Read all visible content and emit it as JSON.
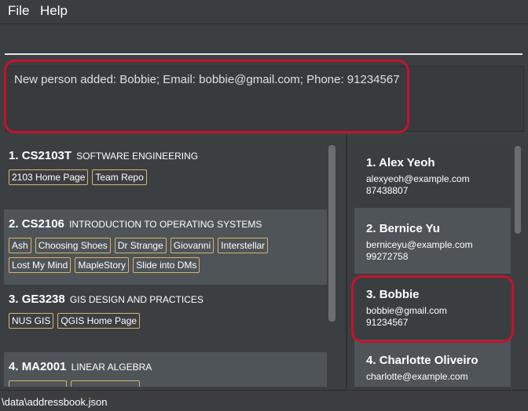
{
  "menu": {
    "file": "File",
    "help": "Help"
  },
  "command": {
    "value": "",
    "placeholder": ""
  },
  "result": {
    "message": "New person added: Bobbie; Email: bobbie@gmail.com; Phone: 91234567"
  },
  "modules": [
    {
      "index": "1.",
      "code": "CS2103T",
      "name": "SOFTWARE ENGINEERING",
      "links": [
        "2103 Home Page",
        "Team Repo"
      ]
    },
    {
      "index": "2.",
      "code": "CS2106",
      "name": "INTRODUCTION TO OPERATING SYSTEMS",
      "links": [
        "Ash",
        "Choosing Shoes",
        "Dr Strange",
        "Giovanni",
        "Interstellar",
        "Lost My Mind",
        "MapleStory",
        "Slide into DMs"
      ]
    },
    {
      "index": "3.",
      "code": "GE3238",
      "name": "GIS DESIGN AND PRACTICES",
      "links": [
        "NUS GIS",
        "QGIS Home Page"
      ]
    },
    {
      "index": "4.",
      "code": "MA2001",
      "name": "LINEAR ALGEBRA",
      "links": []
    }
  ],
  "persons": [
    {
      "index": "1.",
      "name": "Alex Yeoh",
      "email": "alexyeoh@example.com",
      "phone": "87438807"
    },
    {
      "index": "2.",
      "name": "Bernice Yu",
      "email": "berniceyu@example.com",
      "phone": "99272758"
    },
    {
      "index": "3.",
      "name": "Bobbie",
      "email": "bobbie@gmail.com",
      "phone": "91234567"
    },
    {
      "index": "4.",
      "name": "Charlotte Oliveiro",
      "email": "charlotte@example.com",
      "phone": ""
    }
  ],
  "status": {
    "path": "\\data\\addressbook.json"
  },
  "colors": {
    "highlight": "#c8102e",
    "tag_border": "#d9b36c",
    "card_alt": "#4e5457"
  }
}
